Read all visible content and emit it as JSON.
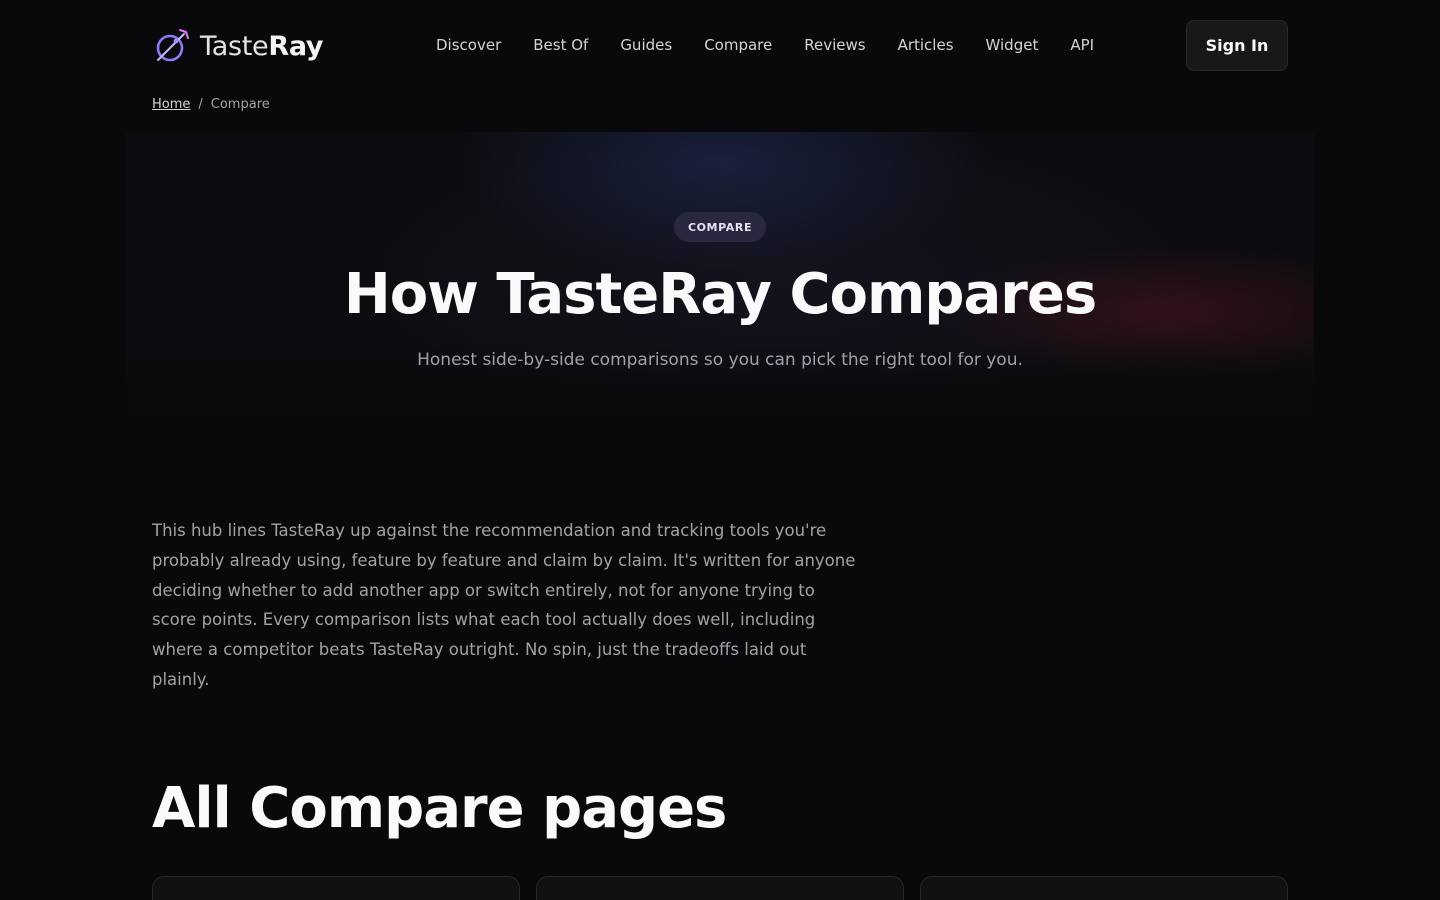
{
  "brand": {
    "name_light": "Taste",
    "name_bold": "Ray",
    "accent_purple": "#8b7cf6",
    "accent_pink": "#c084fc"
  },
  "nav": {
    "items": [
      {
        "label": "Discover"
      },
      {
        "label": "Best Of"
      },
      {
        "label": "Guides"
      },
      {
        "label": "Compare"
      },
      {
        "label": "Reviews"
      },
      {
        "label": "Articles"
      },
      {
        "label": "Widget"
      },
      {
        "label": "API"
      }
    ],
    "signin_label": "Sign In"
  },
  "breadcrumb": {
    "home": "Home",
    "separator": "/",
    "current": "Compare"
  },
  "hero": {
    "badge": "COMPARE",
    "title": "How TasteRay Compares",
    "subtitle": "Honest side-by-side comparisons so you can pick the right tool for you."
  },
  "intro": {
    "text": "This hub lines TasteRay up against the recommendation and tracking tools you're probably already using, feature by feature and claim by claim. It's written for anyone deciding whether to add another app or switch entirely, not for anyone trying to score points. Every comparison lists what each tool actually does well, including where a competitor beats TasteRay outright. No spin, just the tradeoffs laid out plainly."
  },
  "section": {
    "title": "All Compare pages"
  }
}
